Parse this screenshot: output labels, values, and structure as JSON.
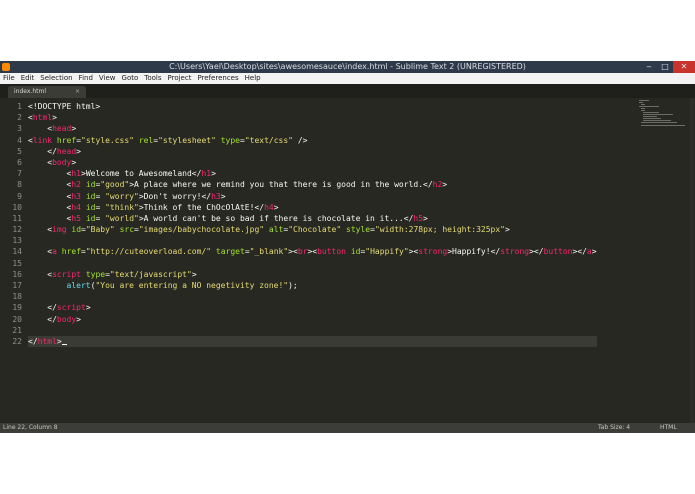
{
  "window": {
    "title": "C:\\Users\\Yael\\Desktop\\sites\\awesomesauce\\index.html - Sublime Text 2 (UNREGISTERED)",
    "controls": {
      "minimize": "‒",
      "maximize": "□",
      "close": "✕"
    }
  },
  "menu": [
    "File",
    "Edit",
    "Selection",
    "Find",
    "View",
    "Goto",
    "Tools",
    "Project",
    "Preferences",
    "Help"
  ],
  "tab": {
    "label": "index.html",
    "close": "×"
  },
  "gutter": [
    "1",
    "2",
    "3",
    "4",
    "5",
    "6",
    "7",
    "8",
    "9",
    "10",
    "11",
    "12",
    "13",
    "14",
    "15",
    "16",
    "17",
    "18",
    "19",
    "20",
    "21",
    "22"
  ],
  "code": {
    "l1": "<!DOCTYPE html>",
    "html_tag": "html",
    "head_tag": "head",
    "link_tag": "link",
    "href_attr": "href",
    "rel_attr": "rel",
    "type_attr": "type",
    "css_file": "\"style.css\"",
    "stylesheet": "\"stylesheet\"",
    "text_css": "\"text/css\"",
    "body_tag": "body",
    "h1_tag": "h1",
    "h1_text": "Welcome to Awesomeland",
    "h2_tag": "h2",
    "id_attr": "id",
    "good": "\"good\"",
    "h2_text": "A place where we remind you that there is good in the world.",
    "h3_tag": "h3",
    "worry": "\"worry\"",
    "h3_text": "Don't worry!",
    "h4_tag": "h4",
    "think": "\"think\"",
    "h4_text": "Think of the ChOcOlAtE!",
    "h5_tag": "h5",
    "world": "\"world\"",
    "h5_text": "A world can't be so bad if there is chocolate in it...",
    "img_tag": "img",
    "baby": "\"Baby\"",
    "src_attr": "src",
    "img_src": "\"images/babychocolate.jpg\"",
    "alt_attr": "alt",
    "alt_val": "\"Chocolate\"",
    "style_attr": "style",
    "style_val": "\"width:278px; height:325px\"",
    "a_tag": "a",
    "a_href": "\"http://cuteoverload.com/\"",
    "target_attr": "target",
    "blank": "\"_blank\"",
    "br_tag": "br",
    "button_tag": "button",
    "happify_id": "\"Happify\"",
    "strong_tag": "strong",
    "strong_text": "Happify!",
    "script_tag": "script",
    "text_js": "\"text/javascript\"",
    "alert_fn": "alert",
    "alert_msg": "\"You are entering a NO negetivity zone!\""
  },
  "status": {
    "position": "Line 22, Column 8",
    "tab_size": "Tab Size: 4",
    "syntax": "HTML"
  },
  "colors": {
    "background": "#272822",
    "tag": "#f92672",
    "attribute": "#a6e22e",
    "string": "#e6db74",
    "function": "#66d9ef"
  }
}
